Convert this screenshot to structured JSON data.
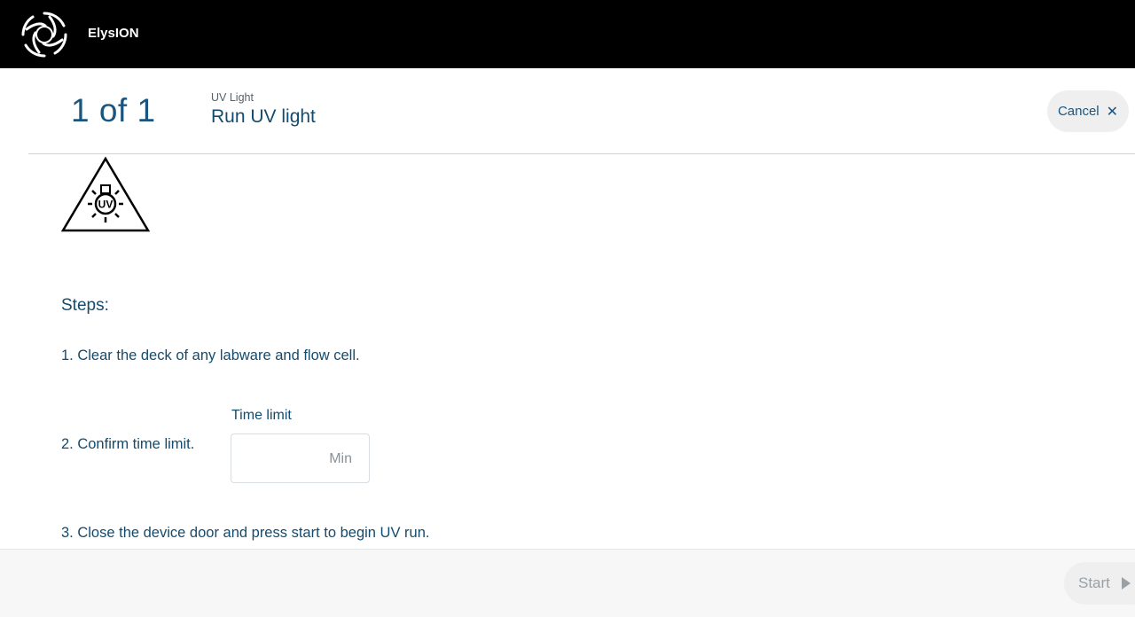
{
  "app": {
    "name": "ElysION",
    "logo_icon": "aperture-swirl-logo"
  },
  "header": {
    "step_counter": "1 of 1",
    "breadcrumb": "UV Light",
    "title": "Run UV light",
    "cancel_label": "Cancel",
    "cancel_icon": "close-icon"
  },
  "hazard": {
    "icon": "uv-warning-icon",
    "text": "UV"
  },
  "steps": {
    "heading": "Steps:",
    "items": [
      "1. Clear the deck of any labware and flow cell.",
      "2. Confirm time limit.",
      "3. Close the device door and press start to begin UV run."
    ]
  },
  "time_limit": {
    "label": "Time limit",
    "value": "",
    "unit": "Min"
  },
  "footer": {
    "start_label": "Start",
    "start_icon": "play-icon"
  },
  "colors": {
    "topbar": "#000000",
    "primary_text": "#134b6e",
    "button_bg": "#efefef",
    "disabled_text": "#9aa1a6"
  }
}
